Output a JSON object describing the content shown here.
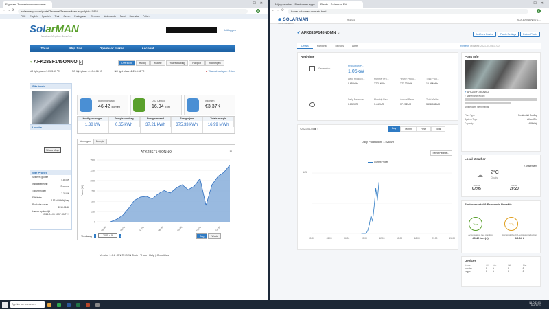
{
  "left_window": {
    "tab_title": "Eigenaar Zonnestroomomvormer",
    "url": "solarmanpv.com/portal/Terminal/TerminalMain.aspx?pid=15854",
    "languages": [
      "PRC",
      "English",
      "Spanish",
      "Thai",
      "Czech",
      "Portuguese",
      "German",
      "Nederlands",
      "Farsi",
      "Svenska",
      "Polish"
    ],
    "logo_main": "Sol",
    "logo_accent": "arMAN",
    "logo_tagline": "Monitored Anytime Anywhere",
    "logout": "Uitloggen",
    "menu": [
      "Thuis",
      "Mijn Site",
      "Openbaar maken",
      "Account"
    ],
    "plant_name": "AFK28SF145ONNO",
    "plant_tabs": [
      "Overzicht",
      "Huidig",
      "Historie",
      "Waarschuwing",
      "Rapport",
      "Instellingen"
    ],
    "strings": [
      "NO light plaav -1.09-3.67 °C",
      "NO light plaav -1.19-4.06 °C",
      "NO light plaav -2.25-5.36 °C"
    ],
    "warning_text": "Waarschuwingen :",
    "warning_count": "0",
    "warning_unit": "item",
    "site_image_label": "Site beeld",
    "locate_label": "Locatie",
    "show_map": "Show Map",
    "profile": {
      "header": "Site Profiel",
      "rows": [
        {
          "label": "Systeem grootte",
          "value": "4.86 kW"
        },
        {
          "label": "Installatiebedrijf:",
          "value": "Sunsolar"
        },
        {
          "label": "Top vermogen",
          "value": "2.32 kW"
        },
        {
          "label": "Efficiëntie",
          "value": "2.53 kWh/kWp/day"
        },
        {
          "label": "Productie datum",
          "value": "2019-06-18"
        },
        {
          "label": "Laatste update tijd",
          "value": "2021-04-05 10:57 GMT +1"
        }
      ]
    },
    "kpis": [
      {
        "label": "Bomen geplant",
        "value": "46.42",
        "unit": "Bomen"
      },
      {
        "label": "CO2 Uitstoot",
        "value": "16.94",
        "unit": "Ton"
      },
      {
        "label": "Inkomen",
        "value": "€3.37K",
        "unit": ""
      }
    ],
    "energy": [
      {
        "label": "Huidig vermogen",
        "value": "1.38 kW"
      },
      {
        "label": "Energie vandaag",
        "value": "0.65 kWh"
      },
      {
        "label": "Energie maand",
        "value": "37.21 kWh"
      },
      {
        "label": "Energie jaar",
        "value": "375.33 kWh"
      },
      {
        "label": "Totale energie",
        "value": "16.99 MWh"
      }
    ],
    "chart_tabs": [
      "Vermogen",
      "Energie"
    ],
    "chart_footer": {
      "label": "Vandaag",
      "date": "2021-4-5",
      "buttons": [
        "Dag",
        "Week"
      ]
    },
    "footer_left": "Version 1.0.2 .CN",
    "footer_links": [
      "IGEN Tech",
      "Thuis",
      "Help",
      "Conditiies"
    ]
  },
  "chart_data": [
    {
      "type": "area",
      "title": "AFK28SF145ONNO",
      "ylabel": "Power (W)",
      "ylim": [
        0,
        1500
      ],
      "yticks": [
        0,
        250,
        500,
        750,
        1000,
        1250,
        1500
      ],
      "x": [
        "05:00",
        "06:00",
        "07:00",
        "08:00",
        "09:00",
        "10:00",
        "11:00"
      ],
      "series": [
        {
          "values": [
            0,
            60,
            150,
            320,
            520,
            600,
            620,
            560,
            680,
            760,
            700,
            820,
            900,
            780,
            860,
            1050,
            400,
            900,
            1100,
            1200,
            1380
          ]
        }
      ]
    },
    {
      "type": "line",
      "title": "Daily Production: 1.02kWh",
      "ylabel": "kW",
      "ylim": [
        0,
        2
      ],
      "x": [
        "00:00",
        "03:00",
        "06:00",
        "09:00",
        "12:00",
        "15:00",
        "18:00",
        "21:00",
        "24:00"
      ],
      "series": [
        {
          "name": "Current Power",
          "values": [
            0,
            0,
            0,
            0,
            0.1,
            0.3,
            0.6,
            0.4,
            0.9,
            1.5,
            1.1,
            1.7
          ]
        }
      ]
    }
  ],
  "right_window": {
    "tab_title": "Plants - Solarman PV",
    "tab_other": "Mijng weather - Elektroniek apps",
    "url": "home.solarman.cn/main.html",
    "logo": "SOLARMAN",
    "logo_sub": "SMART ENERGY",
    "nav": "Plants",
    "user": "SOLARMAN ID L...",
    "plant_name": "AFK28SF145NOMN",
    "header_buttons": [
      "Add New Device",
      "Plants Settings",
      "Delete Plants"
    ],
    "tabs": [
      "Details",
      "Plant Info",
      "Devices",
      "Alerts"
    ],
    "refresh": "Refresh",
    "updated": "Updated: 2021-04-05 11:00",
    "realtime": {
      "title": "Real-time",
      "generation_label": "Generation",
      "production_label": "Production P...",
      "production_value": "1.05kW",
      "gen_stats": [
        {
          "label": "Daily Producti...",
          "value": "0.65kWh"
        },
        {
          "label": "Monthly Pro...",
          "value": "37.21kWh"
        },
        {
          "label": "Yearly Produ...",
          "value": "377.33kWh"
        },
        {
          "label": "Total Prod...",
          "value": "16.99MWh"
        }
      ],
      "rev_stats": [
        {
          "label": "Daily Revenue",
          "value": "0.13EUR"
        },
        {
          "label": "Monthly Rev...",
          "value": "7.44EUR"
        },
        {
          "label": "Annual Reve...",
          "value": "77.20EUR"
        },
        {
          "label": "Total Yields",
          "value": "3398.04EUR"
        }
      ]
    },
    "chart_date": "2021-04-05",
    "period_buttons": [
      "Day",
      "Month",
      "Year",
      "Total"
    ],
    "select_param": "Select Paramet...",
    "plant_info": {
      "title": "Plant Info",
      "name": "AFK28SF145ONNO",
      "country": "Netherlands/Noord",
      "extra": "Amsterdam, Netherlands",
      "rows": [
        {
          "label": "Plant Type",
          "value": "Residential Rooftop"
        },
        {
          "label": "System Type",
          "value": "All on Grid"
        },
        {
          "label": "Capacity",
          "value": "4.86kWp"
        }
      ]
    },
    "weather": {
      "title": "Local Weather",
      "city": "Amsterdam",
      "temp": "2°C",
      "cond": "Clouds",
      "sunrise_label": "Sunrise",
      "sunrise": "07:05",
      "sunset_label": "Sunset",
      "sunset": "20:20"
    },
    "benefits": {
      "title": "Environmental & Economic Benefits",
      "tree": "Tree",
      "tree_label": "Accumulative tree planting",
      "tree_value": "46.42 tree(s)",
      "co2": "CO₂",
      "co2_label": "Accumulative CO₂ emission reduction",
      "co2_value": "16.94 t"
    },
    "devices": {
      "title": "Devices",
      "headers": [
        "Name",
        "All",
        "Nor...",
        "Offl...",
        "Alar..."
      ],
      "rows": [
        [
          "Inverter",
          "1",
          "1",
          "0",
          "0"
        ],
        [
          "Logger",
          "1",
          "1",
          "0",
          "0"
        ]
      ]
    }
  },
  "taskbar": {
    "search": "Typ hier om te zoeken",
    "time": "11:01",
    "date": "5-4-2021",
    "lang": "NLD"
  }
}
